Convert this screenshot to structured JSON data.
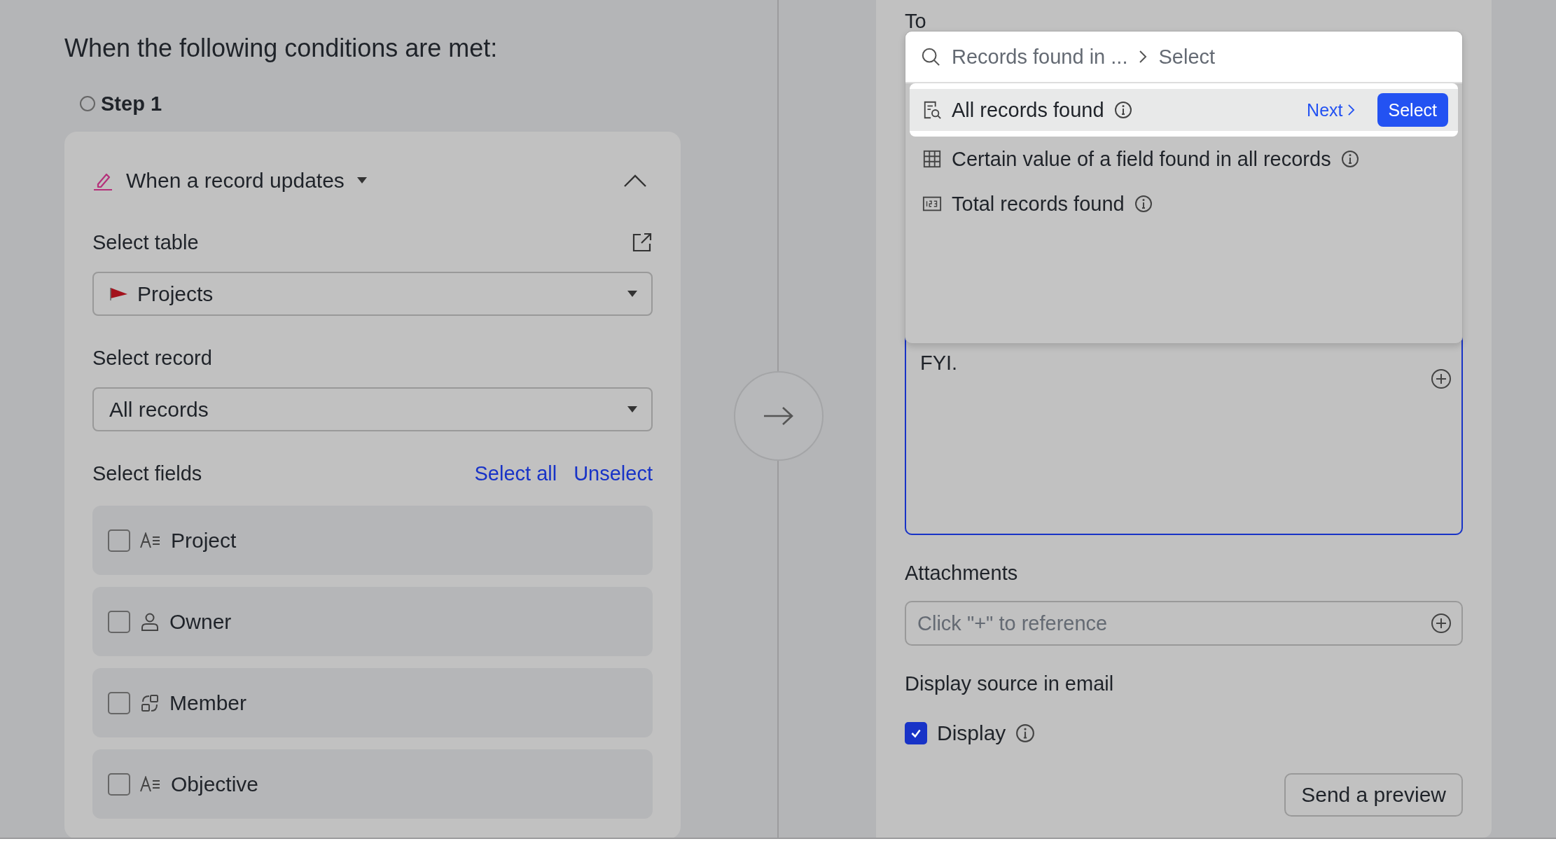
{
  "heading": "When the following conditions are met:",
  "step": {
    "label": "Step 1"
  },
  "trigger": {
    "title": "When a record updates",
    "expanded": true,
    "table": {
      "label": "Select table",
      "value": "Projects"
    },
    "record": {
      "label": "Select record",
      "value": "All records"
    },
    "fields": {
      "label": "Select fields",
      "select_all": "Select all",
      "unselect": "Unselect",
      "items": [
        {
          "name": "Project",
          "kind": "text",
          "checked": false
        },
        {
          "name": "Owner",
          "kind": "person",
          "checked": false
        },
        {
          "name": "Member",
          "kind": "member",
          "checked": false
        },
        {
          "name": "Objective",
          "kind": "text",
          "checked": false
        }
      ]
    }
  },
  "email": {
    "to_label": "To",
    "picker": {
      "search": "Records found in ...",
      "crumb": "Select",
      "options": [
        {
          "label": "All records found",
          "kind": "records",
          "selected": true,
          "next": "Next",
          "action": "Select"
        },
        {
          "label": "Certain value of a field found in all records",
          "kind": "grid",
          "selected": false
        },
        {
          "label": "Total records found",
          "kind": "count",
          "selected": false
        }
      ]
    },
    "body": "FYI.",
    "attachments": {
      "label": "Attachments",
      "placeholder": "Click \"+\" to reference"
    },
    "source": {
      "label": "Display source in email",
      "option": "Display",
      "checked": true
    },
    "preview_button": "Send a preview"
  }
}
